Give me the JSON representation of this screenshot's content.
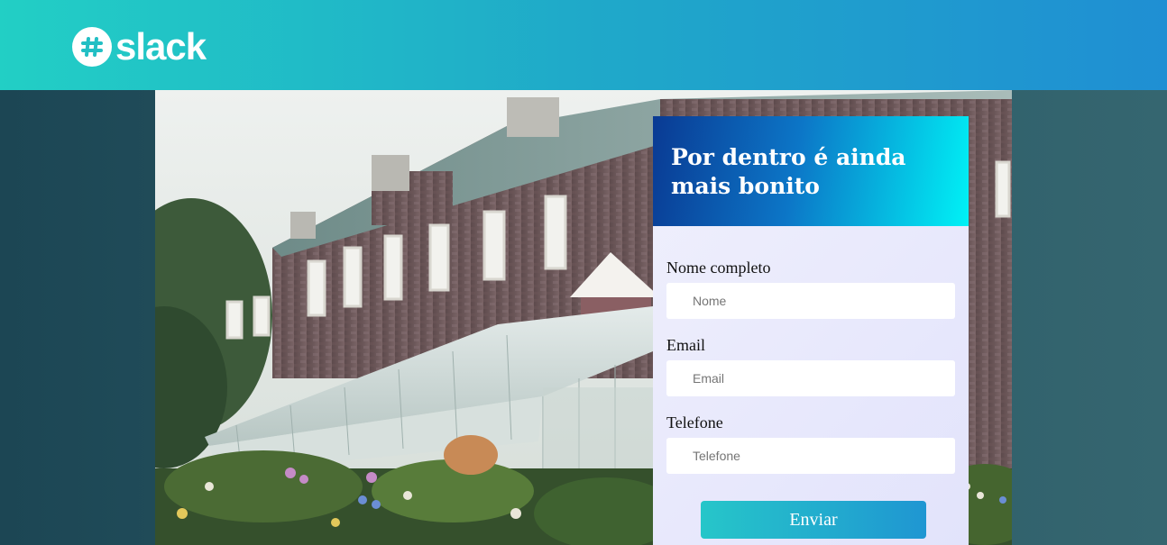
{
  "header": {
    "logo_text": "slack",
    "logo_icon": "slack-hash-icon",
    "gradient": [
      "#22cfc5",
      "#1f8fd3"
    ]
  },
  "hero": {
    "image": "stone-house-with-greenhouse-and-garden-photo"
  },
  "form": {
    "title": "Por dentro é ainda mais bonito",
    "fields": [
      {
        "label": "Nome completo",
        "placeholder": "Nome"
      },
      {
        "label": "Email",
        "placeholder": "Email"
      },
      {
        "label": "Telefone",
        "placeholder": "Telefone"
      }
    ],
    "submit_label": "Enviar"
  },
  "colors": {
    "background": "#1c4654",
    "form_header_start": "#0a3a93",
    "form_header_end": "#00f2f6",
    "button_start": "#26c6c9",
    "button_end": "#1f96d2"
  }
}
